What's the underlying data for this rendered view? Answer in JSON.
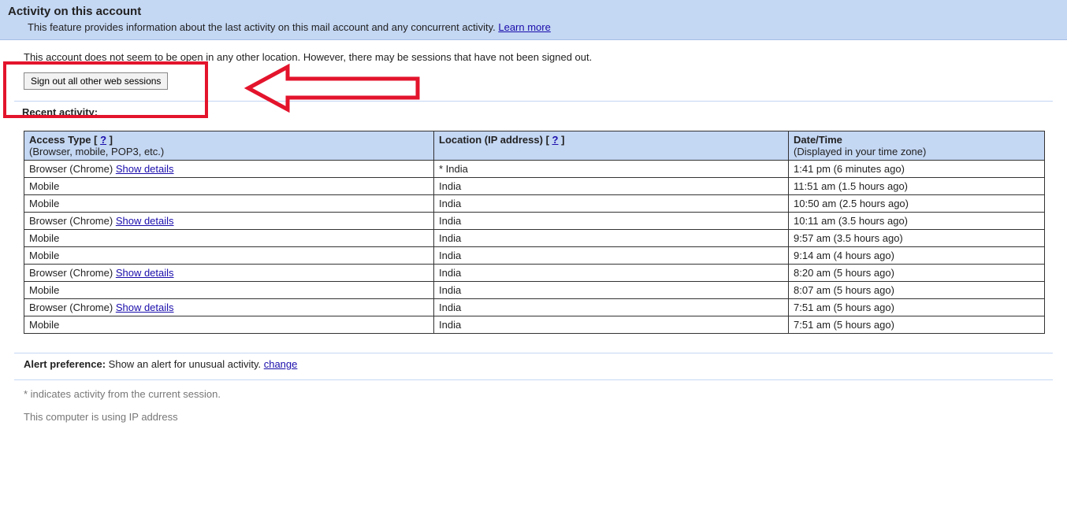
{
  "header": {
    "title": "Activity on this account",
    "feature_desc": "This feature provides information about the last activity on this mail account and any concurrent activity.",
    "learn_more": "Learn more"
  },
  "open_location": "This account does not seem to be open in any other location. However, there may be sessions that have not been signed out.",
  "signout_button": "Sign out all other web sessions",
  "recent_activity_heading": "Recent activity:",
  "table": {
    "access_type_header": "Access Type",
    "access_type_help": "?",
    "access_type_sub": "(Browser, mobile, POP3, etc.)",
    "location_header": "Location (IP address)",
    "location_help": "?",
    "datetime_header": "Date/Time",
    "datetime_sub": "(Displayed in your time zone)",
    "show_details": "Show details",
    "rows": [
      {
        "access": "Browser (Chrome)",
        "has_details": true,
        "location": "* India",
        "datetime": "1:41 pm (6 minutes ago)"
      },
      {
        "access": "Mobile",
        "has_details": false,
        "location": "India",
        "datetime": "11:51 am (1.5 hours ago)"
      },
      {
        "access": "Mobile",
        "has_details": false,
        "location": "India",
        "datetime": "10:50 am (2.5 hours ago)"
      },
      {
        "access": "Browser (Chrome)",
        "has_details": true,
        "location": "India",
        "datetime": "10:11 am (3.5 hours ago)"
      },
      {
        "access": "Mobile",
        "has_details": false,
        "location": "India",
        "datetime": "9:57 am (3.5 hours ago)"
      },
      {
        "access": "Mobile",
        "has_details": false,
        "location": "India",
        "datetime": "9:14 am (4 hours ago)"
      },
      {
        "access": "Browser (Chrome)",
        "has_details": true,
        "location": "India",
        "datetime": "8:20 am (5 hours ago)"
      },
      {
        "access": "Mobile",
        "has_details": false,
        "location": "India",
        "datetime": "8:07 am (5 hours ago)"
      },
      {
        "access": "Browser (Chrome)",
        "has_details": true,
        "location": "India",
        "datetime": "7:51 am (5 hours ago)"
      },
      {
        "access": "Mobile",
        "has_details": false,
        "location": "India",
        "datetime": "7:51 am (5 hours ago)"
      }
    ]
  },
  "alert": {
    "label": "Alert preference:",
    "text": "Show an alert for unusual activity.",
    "change": "change"
  },
  "footer": {
    "asterisk": "* indicates activity from the current session.",
    "ip_line": "This computer is using IP address"
  },
  "colors": {
    "band": "#c4d7f3",
    "highlight": "#e3142c",
    "link": "#1a0dab"
  }
}
